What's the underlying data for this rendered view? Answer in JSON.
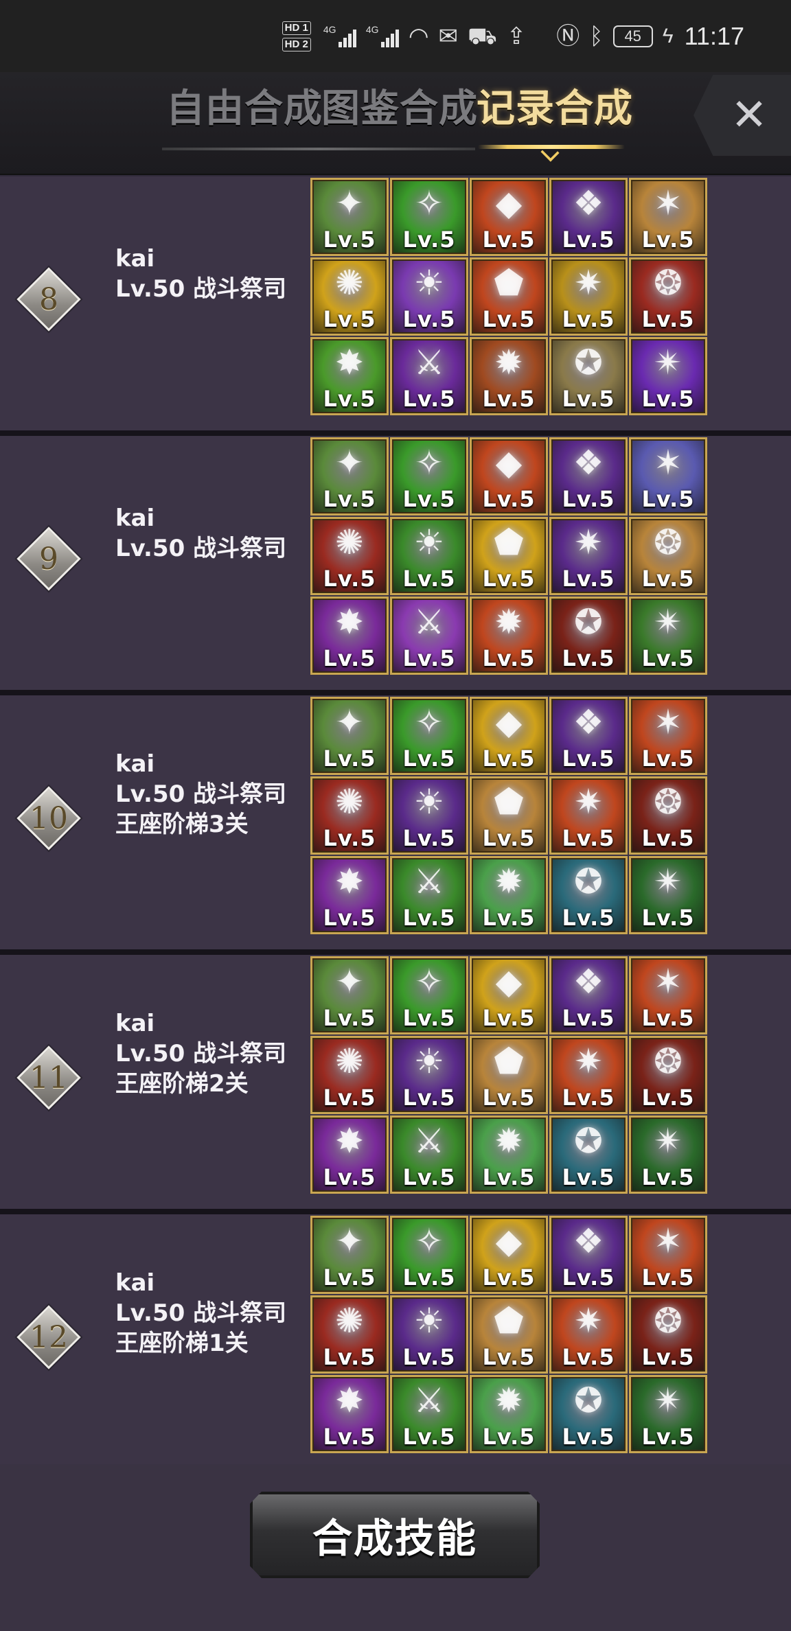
{
  "status_bar": {
    "hd1": "HD 1",
    "hd2": "HD 2",
    "net1": "4G",
    "net2": "4G",
    "battery": "45",
    "time": "11:17"
  },
  "tabs": [
    {
      "label": "自由合成",
      "active": false
    },
    {
      "label": "图鉴合成",
      "active": false
    },
    {
      "label": "记录合成",
      "active": true
    }
  ],
  "close_label": "✕",
  "skill_level_label": "Lv.5",
  "records": [
    {
      "rank": "8",
      "name": "kai",
      "class": "Lv.50 战斗祭司",
      "note": "",
      "skills": [
        "#5a8a3a",
        "#3a9a2a",
        "#c0461e",
        "#5a2a8a",
        "#b8843a",
        "#d0a21a",
        "#7a3ab0",
        "#c0461e",
        "#b8901a",
        "#9a2a20",
        "#4a9a2a",
        "#6a2a9a",
        "#a04a20",
        "#8a7a4a",
        "#6a2ab0"
      ]
    },
    {
      "rank": "9",
      "name": "kai",
      "class": "Lv.50 战斗祭司",
      "note": "",
      "skills": [
        "#5a8a3a",
        "#3a9a2a",
        "#c0461e",
        "#5a2a8a",
        "#5a5ab0",
        "#9a2a20",
        "#3a8a2a",
        "#d0a21a",
        "#5a2a8a",
        "#b8843a",
        "#7a2a9a",
        "#8a3ab0",
        "#c0461e",
        "#7a2218",
        "#3a7a2a"
      ]
    },
    {
      "rank": "10",
      "name": "kai",
      "class": "Lv.50 战斗祭司",
      "note": "王座阶梯3关",
      "skills": [
        "#5a8a3a",
        "#3a9a2a",
        "#d0a21a",
        "#5a2a8a",
        "#c0461e",
        "#9a2a20",
        "#5a2a8a",
        "#b8843a",
        "#c0461e",
        "#7a2218",
        "#7a2a9a",
        "#3a8a2a",
        "#4aa04a",
        "#2a6a7a",
        "#2a6a2a"
      ]
    },
    {
      "rank": "11",
      "name": "kai",
      "class": "Lv.50 战斗祭司",
      "note": "王座阶梯2关",
      "skills": [
        "#5a8a3a",
        "#3a9a2a",
        "#d0a21a",
        "#5a2a8a",
        "#c0461e",
        "#9a2a20",
        "#5a2a8a",
        "#b8843a",
        "#c0461e",
        "#7a2218",
        "#7a2a9a",
        "#3a8a2a",
        "#4aa04a",
        "#2a6a7a",
        "#2a6a2a"
      ]
    },
    {
      "rank": "12",
      "name": "kai",
      "class": "Lv.50 战斗祭司",
      "note": "王座阶梯1关",
      "skills": [
        "#5a8a3a",
        "#3a9a2a",
        "#d0a21a",
        "#5a2a8a",
        "#c0461e",
        "#9a2a20",
        "#5a2a8a",
        "#b8843a",
        "#c0461e",
        "#7a2218",
        "#7a2a9a",
        "#3a8a2a",
        "#4aa04a",
        "#2a6a7a",
        "#2a6a2a"
      ]
    }
  ],
  "merge_button": "合成技能"
}
